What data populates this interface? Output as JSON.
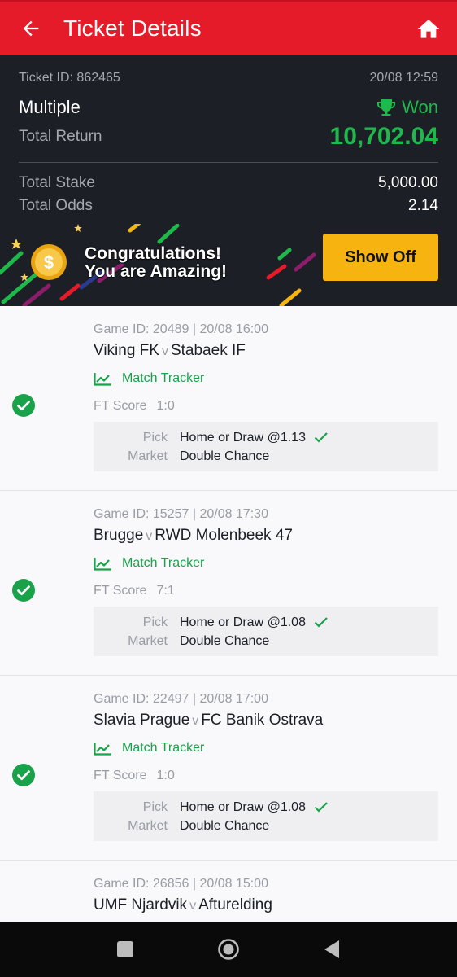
{
  "header": {
    "title": "Ticket Details"
  },
  "ticket": {
    "id_label": "Ticket ID: 862465",
    "datetime": "20/08 12:59",
    "bet_type": "Multiple",
    "status": "Won",
    "total_return_label": "Total Return",
    "total_return": "10,702.04",
    "total_stake_label": "Total Stake",
    "total_stake": "5,000.00",
    "total_odds_label": "Total Odds",
    "total_odds": "2.14"
  },
  "promo": {
    "line1": "Congratulations!",
    "line2": "You are Amazing!",
    "button": "Show Off"
  },
  "labels": {
    "match_tracker": "Match Tracker",
    "ft_score": "FT Score",
    "pick": "Pick",
    "market": "Market",
    "vs": "v"
  },
  "selections": [
    {
      "game_meta": "Game ID: 20489 | 20/08 16:00",
      "home": "Viking FK",
      "away": "Stabaek IF",
      "ft_score": "1:0",
      "pick": "Home or Draw @1.13",
      "market": "Double Chance"
    },
    {
      "game_meta": "Game ID: 15257 | 20/08 17:30",
      "home": "Brugge",
      "away": "RWD Molenbeek 47",
      "ft_score": "7:1",
      "pick": "Home or Draw @1.08",
      "market": "Double Chance"
    },
    {
      "game_meta": "Game ID: 22497 | 20/08 17:00",
      "home": "Slavia Prague",
      "away": "FC Banik Ostrava",
      "ft_score": "1:0",
      "pick": "Home or Draw @1.08",
      "market": "Double Chance"
    },
    {
      "game_meta": "Game ID: 26856 | 20/08 15:00",
      "home": "UMF Njardvik",
      "away": "Afturelding"
    }
  ],
  "colors": {
    "header_red": "#e51b2a",
    "summary_bg": "#1d1f27",
    "win_green": "#1fb84b",
    "button_yellow": "#f7b30f"
  },
  "icons": {
    "back": "arrow-left-icon",
    "home": "home-icon",
    "won": "trophy-icon",
    "tracker": "chart-line-icon",
    "selection_status": "check-circle-icon",
    "pick_status": "check-icon"
  }
}
